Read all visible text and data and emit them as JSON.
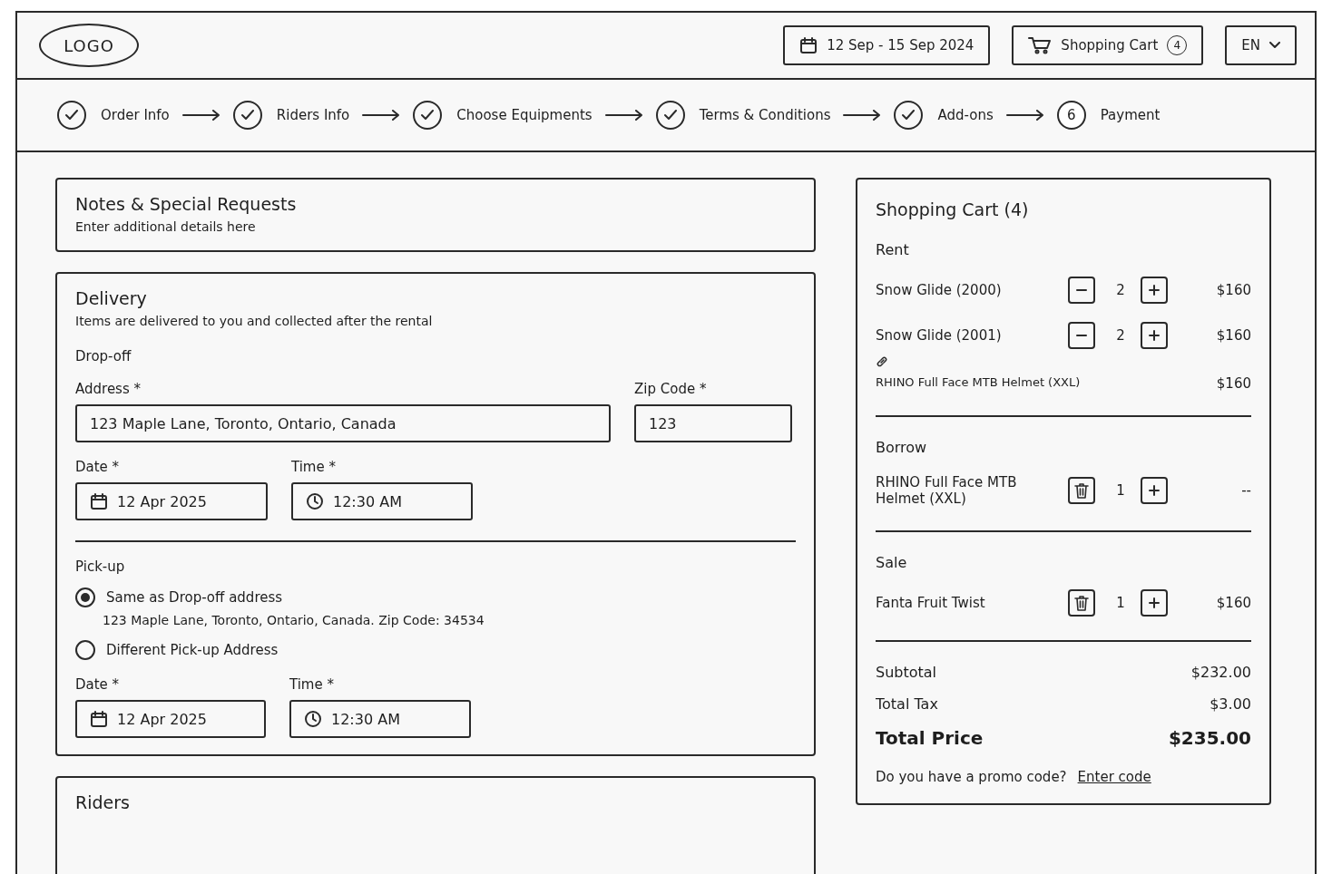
{
  "header": {
    "logo": "LOGO",
    "date_range": "12 Sep - 15 Sep 2024",
    "cart_label": "Shopping Cart",
    "cart_count": "4",
    "language": "EN"
  },
  "steps": [
    {
      "label": "Order Info",
      "done": true
    },
    {
      "label": "Riders Info",
      "done": true
    },
    {
      "label": "Choose Equipments",
      "done": true
    },
    {
      "label": "Terms & Conditions",
      "done": true
    },
    {
      "label": "Add-ons",
      "done": true
    },
    {
      "label": "Payment",
      "done": false,
      "number": "6"
    }
  ],
  "notes": {
    "title": "Notes & Special Requests",
    "placeholder": "Enter additional details here"
  },
  "delivery": {
    "title": "Delivery",
    "subtitle": "Items are delivered to you and collected after the rental",
    "dropoff_title": "Drop-off",
    "address": {
      "label": "Address *",
      "value": "123 Maple Lane, Toronto, Ontario, Canada"
    },
    "zip": {
      "label": "Zip Code *",
      "value": "123"
    },
    "date": {
      "label": "Date *",
      "value": "12 Apr 2025"
    },
    "time": {
      "label": "Time *",
      "value": "12:30 AM"
    },
    "pickup_title": "Pick-up",
    "pickup_options": [
      {
        "label": "Same as Drop-off address",
        "detail": "123 Maple Lane, Toronto, Ontario, Canada.  Zip Code: 34534",
        "selected": true
      },
      {
        "label": "Different Pick-up Address",
        "selected": false
      }
    ],
    "pickup_date": {
      "label": "Date *",
      "value": "12 Apr 2025"
    },
    "pickup_time": {
      "label": "Time *",
      "value": "12:30 AM"
    }
  },
  "riders": {
    "title": "Riders"
  },
  "cart": {
    "title": "Shopping Cart (4)",
    "sections": [
      {
        "title": "Rent",
        "items": [
          {
            "kind": "stepper",
            "name": "Snow Glide (2000)",
            "count": "2",
            "price": "$160"
          },
          {
            "kind": "stepper",
            "name": "Snow Glide (2001)",
            "count": "2",
            "price": "$160"
          },
          {
            "kind": "attached",
            "name": "RHINO Full Face MTB Helmet (XXL)",
            "price": "$160"
          }
        ]
      },
      {
        "title": "Borrow",
        "items": [
          {
            "kind": "removable",
            "name": "RHINO Full Face MTB Helmet (XXL)",
            "count": "1",
            "price": "--"
          }
        ]
      },
      {
        "title": "Sale",
        "items": [
          {
            "kind": "removable",
            "name": "Fanta Fruit Twist",
            "count": "1",
            "price": "$160"
          }
        ]
      }
    ],
    "totals": [
      {
        "label": "Subtotal",
        "value": "$232.00",
        "grand": false
      },
      {
        "label": "Total Tax",
        "value": "$3.00",
        "grand": false
      },
      {
        "label": "Total Price",
        "value": "$235.00",
        "grand": true
      }
    ],
    "promo_text": "Do you have a promo code?",
    "promo_link": "Enter code"
  }
}
